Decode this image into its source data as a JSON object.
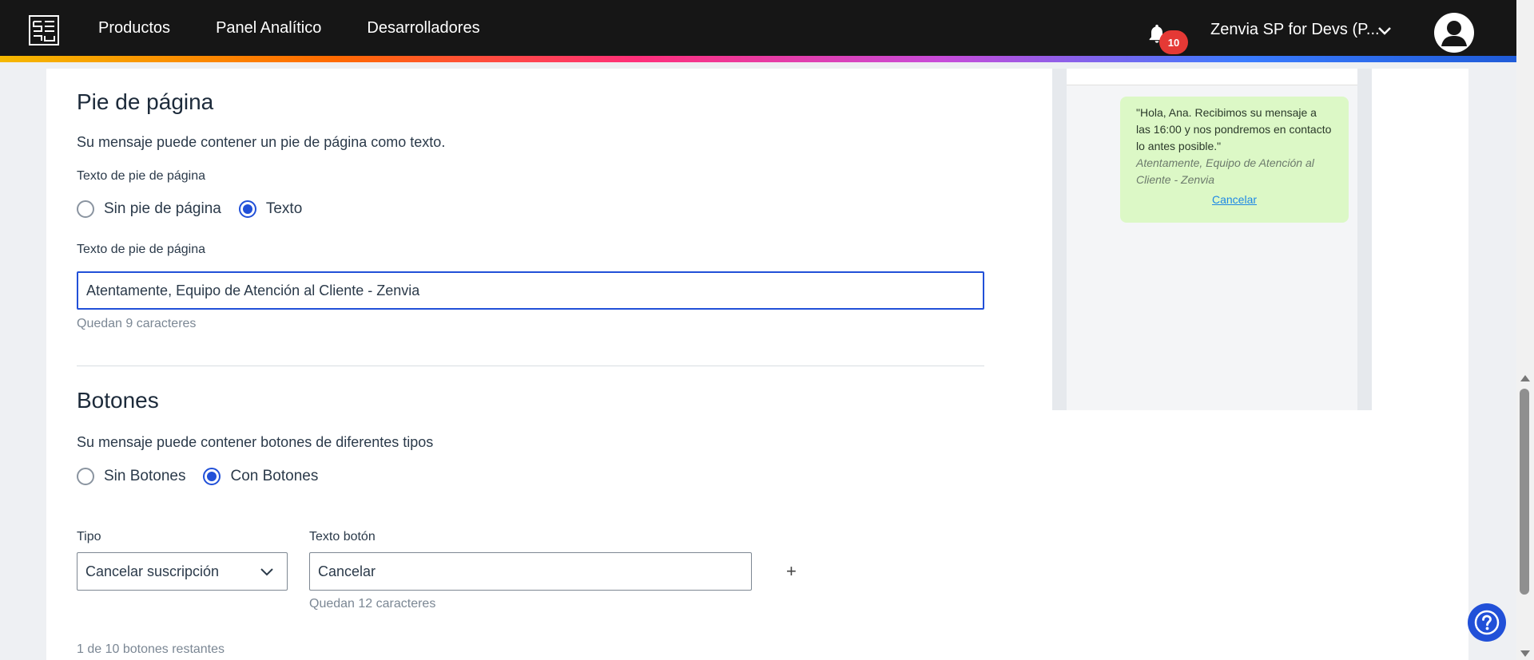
{
  "header": {
    "nav": [
      "Productos",
      "Panel Analítico",
      "Desarrolladores"
    ],
    "notifications_count": "10",
    "account_name": "Zenvia SP for Devs (P..."
  },
  "footer_section": {
    "title": "Pie de página",
    "description": "Su mensaje puede contener un pie de página como texto.",
    "type_label": "Texto de pie de página",
    "options": [
      "Sin pie de página",
      "Texto"
    ],
    "selected": "Texto",
    "text_label": "Texto de pie de página",
    "text_value": "Atentamente, Equipo de Atención al Cliente - Zenvia",
    "remaining": "Quedan 9 caracteres"
  },
  "buttons_section": {
    "title": "Botones",
    "description": "Su mensaje puede contener botones de diferentes tipos",
    "options": [
      "Sin Botones",
      "Con Botones"
    ],
    "selected": "Con Botones",
    "type_label": "Tipo",
    "type_value": "Cancelar suscripción",
    "text_label": "Texto botón",
    "text_value": "Cancelar",
    "text_remaining": "Quedan 12 caracteres",
    "add_symbol": "+",
    "buttons_left": "1 de 10 botones restantes"
  },
  "preview": {
    "message": "\"Hola, Ana. Recibimos su mensaje a las 16:00 y nos pondremos en contacto lo antes posible.\"",
    "footer": "Atentamente, Equipo de Atención al Cliente - Zenvia",
    "button": "Cancelar"
  },
  "colors": {
    "header_bg": "#161616",
    "accent": "#2150d8",
    "bubble": "#dcf8c6",
    "badge": "#e53935"
  }
}
